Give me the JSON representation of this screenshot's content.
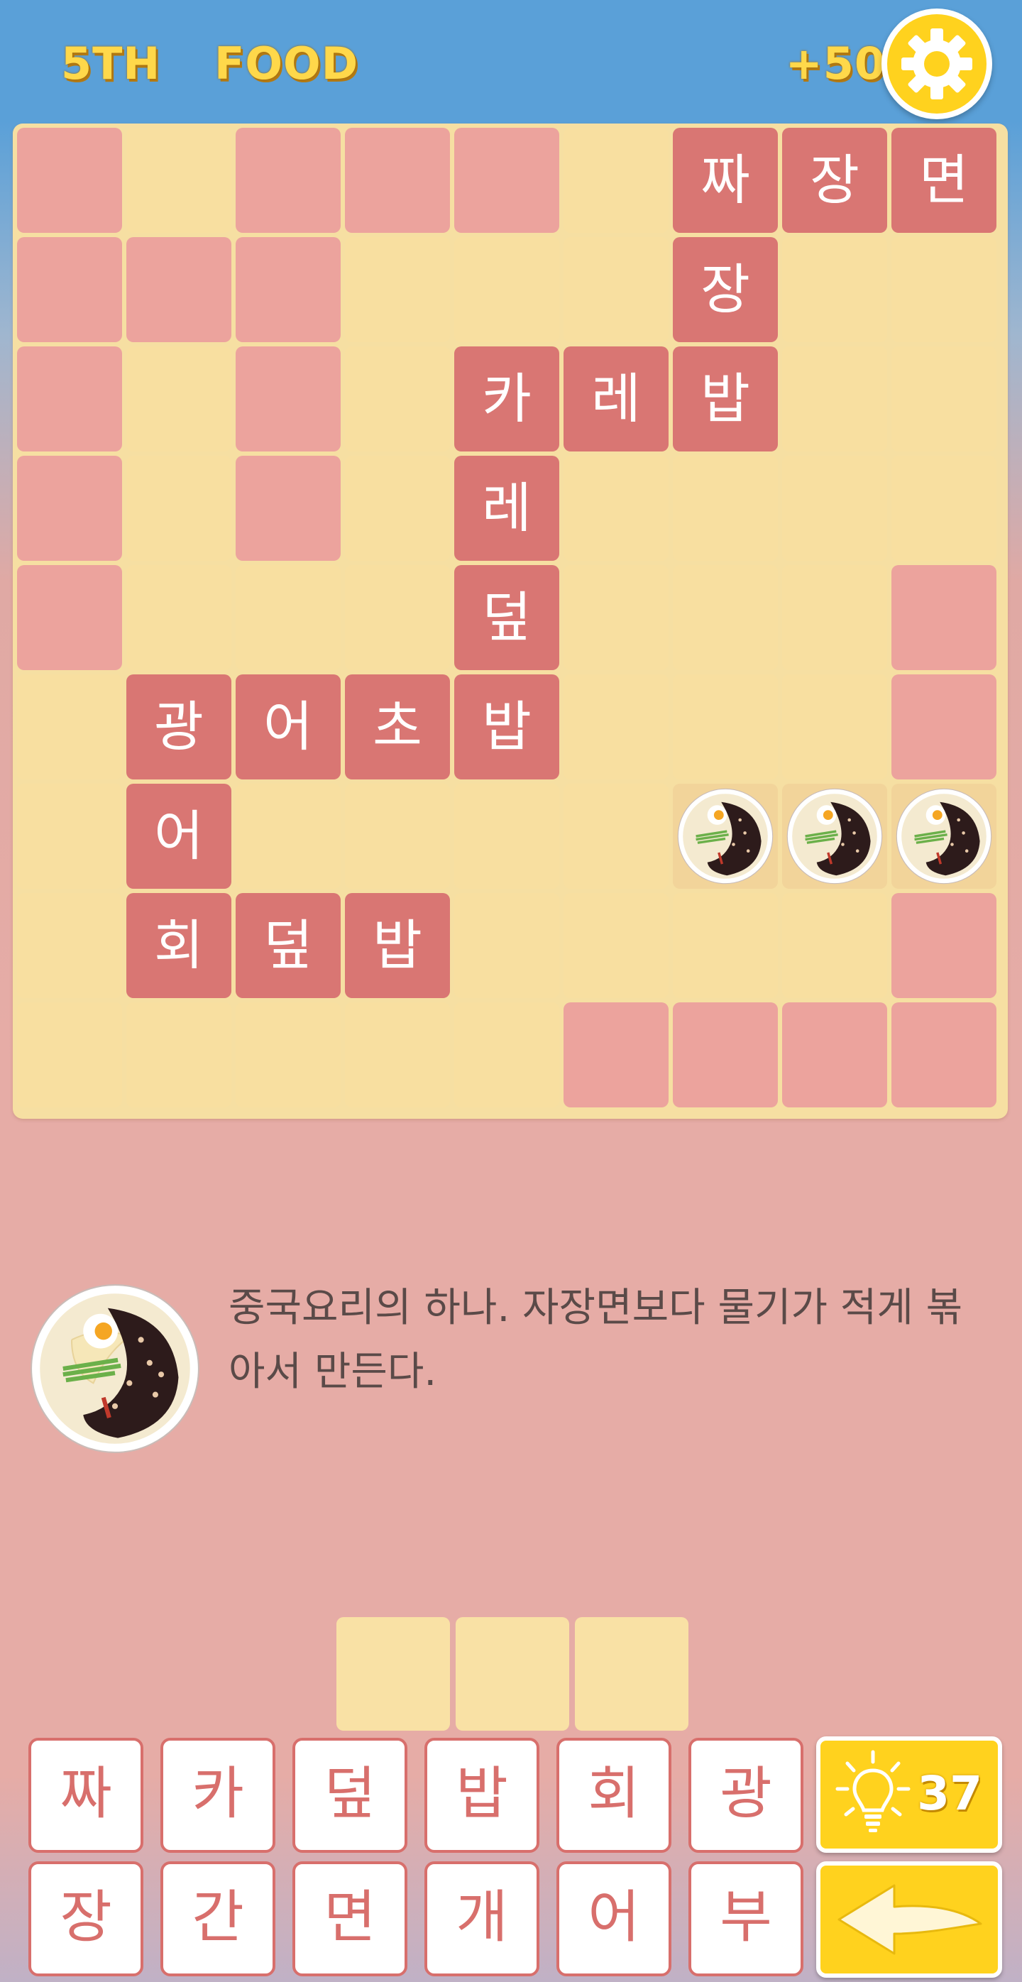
{
  "header": {
    "level": "5TH",
    "category": "FOOD",
    "score": "+50"
  },
  "board": {
    "rows": [
      [
        "X",
        ".",
        "X",
        "X",
        "X",
        ".",
        "짜",
        "장",
        "면"
      ],
      [
        "X",
        "X",
        "X",
        ".",
        ".",
        ".",
        "장",
        ".",
        "."
      ],
      [
        "X",
        ".",
        "X",
        ".",
        "카",
        "레",
        "밥",
        ".",
        "."
      ],
      [
        "X",
        ".",
        "X",
        ".",
        "레",
        ".",
        ".",
        ".",
        "."
      ],
      [
        "X",
        ".",
        ".",
        ".",
        "덮",
        ".",
        ".",
        ".",
        "X"
      ],
      [
        ".",
        "광",
        "어",
        "초",
        "밥",
        ".",
        ".",
        ".",
        "X"
      ],
      [
        ".",
        "어",
        ".",
        ".",
        ".",
        ".",
        "@",
        "@",
        "@"
      ],
      [
        ".",
        "회",
        "덮",
        "밥",
        ".",
        ".",
        ".",
        ".",
        "X"
      ],
      [
        ".",
        ".",
        ".",
        ".",
        ".",
        "X",
        "X",
        "X",
        "X"
      ]
    ]
  },
  "clue": {
    "text": "중국요리의 하나. 자장면보다 물기가 적게 볶아서 만든다.",
    "icon": "jajang-bowl-icon"
  },
  "answer_slots": 3,
  "keyboard": {
    "row1": [
      "짜",
      "카",
      "덮",
      "밥",
      "회",
      "광"
    ],
    "row2": [
      "장",
      "간",
      "면",
      "개",
      "어",
      "부"
    ]
  },
  "hint": {
    "count": "37",
    "icon": "lightbulb-icon"
  },
  "back": {
    "icon": "back-arrow-icon"
  },
  "colors": {
    "letter_tile": "#d97673",
    "blocked_tile": "#eca39d",
    "empty_tile": "#f8dfa0",
    "accent": "#ffd21e"
  }
}
